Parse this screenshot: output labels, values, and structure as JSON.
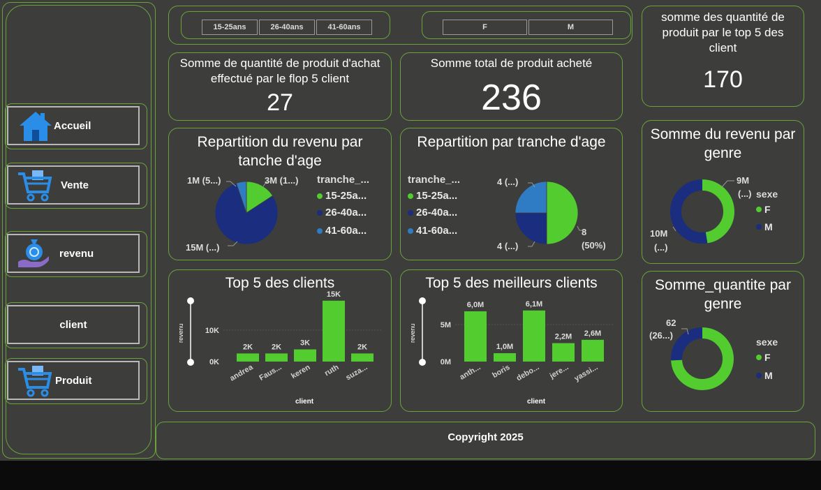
{
  "nav": {
    "items": [
      {
        "label": "Accueil",
        "icon": "home-icon"
      },
      {
        "label": "Vente",
        "icon": "cart-icon"
      },
      {
        "label": "revenu",
        "icon": "money-bag-icon"
      },
      {
        "label": "client",
        "icon": ""
      },
      {
        "label": "Produit",
        "icon": "cart-icon"
      }
    ]
  },
  "slicers": {
    "age": [
      "15-25ans",
      "26-40ans",
      "41-60ans"
    ],
    "gender": [
      "F",
      "M"
    ]
  },
  "kpis": {
    "flop5": {
      "title": "Somme de quantité de produit d'achat effectué par le flop 5 client",
      "value": "27"
    },
    "total": {
      "title": "Somme total de produit acheté",
      "value": "236"
    },
    "top5": {
      "title": "somme des quantité de produit par le top 5 des client",
      "value": "170"
    }
  },
  "colors": {
    "green": "#52cc2e",
    "navy": "#1b2d7e",
    "blue": "#2f7cc4",
    "border": "#6ba33a"
  },
  "chart_data": [
    {
      "type": "pie",
      "title": "Repartition du revenu par tanche d'age",
      "legend_title": "tranche_...",
      "categories": [
        "15-25a...",
        "26-40a...",
        "41-60a..."
      ],
      "values": [
        3,
        15,
        1
      ],
      "data_labels": [
        "3M (1...)",
        "15M (...)",
        "1M (5...)"
      ],
      "legend_position": "right"
    },
    {
      "type": "pie",
      "title": "Repartition par tranche d'age",
      "legend_title": "tranche_...",
      "categories": [
        "15-25a...",
        "26-40a...",
        "41-60a..."
      ],
      "values": [
        8,
        4,
        4
      ],
      "data_labels": [
        "8 (50%)",
        "4 (...)",
        "4 (...)"
      ],
      "legend_position": "left"
    },
    {
      "type": "pie",
      "title": "Somme du revenu par genre",
      "legend_title": "sexe",
      "categories": [
        "F",
        "M"
      ],
      "values": [
        9,
        10
      ],
      "data_labels": [
        "9M (...)",
        "10M (...)"
      ],
      "legend_position": "right"
    },
    {
      "type": "bar",
      "title": "Top 5 des clients",
      "xlabel": "client",
      "ylabel": "revenu",
      "categories": [
        "andrea",
        "Faus...",
        "keren",
        "ruth",
        "suza..."
      ],
      "values": [
        2000,
        2000,
        3000,
        15000,
        2000
      ],
      "data_labels": [
        "2K",
        "2K",
        "3K",
        "15K",
        "2K"
      ],
      "yticks": [
        "0K",
        "10K"
      ],
      "ylim": [
        0,
        16000
      ]
    },
    {
      "type": "bar",
      "title": "Top 5 des meilleurs clients",
      "xlabel": "client",
      "ylabel": "revenu",
      "categories": [
        "anth...",
        "boris",
        "debo...",
        "jere...",
        "yassi..."
      ],
      "values": [
        6000000,
        1000000,
        6100000,
        2200000,
        2600000
      ],
      "data_labels": [
        "6,0M",
        "1,0M",
        "6,1M",
        "2,2M",
        "2,6M"
      ],
      "yticks": [
        "0M",
        "5M"
      ],
      "ylim": [
        0,
        6500000
      ]
    },
    {
      "type": "pie",
      "title": "Somme_quantite par genre",
      "legend_title": "sexe",
      "categories": [
        "F",
        "M"
      ],
      "values": [
        74,
        26
      ],
      "data_labels": [
        "62 (26...)"
      ],
      "legend_position": "right"
    }
  ],
  "footer": {
    "copyright": "Copyright 2025"
  }
}
